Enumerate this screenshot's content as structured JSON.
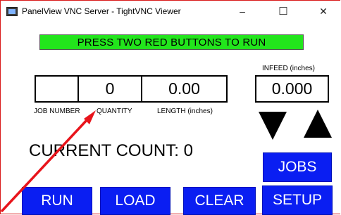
{
  "window": {
    "title": "PanelView VNC Server - TightVNC Viewer",
    "controls": {
      "minimize": "–",
      "maximize": "☐",
      "close": "✕"
    }
  },
  "banner": {
    "text": "PRESS TWO RED BUTTONS TO RUN",
    "color": "#22e51c"
  },
  "fields": {
    "job_number": {
      "value": "",
      "label": "JOB NUMBER"
    },
    "quantity": {
      "value": "0",
      "label": "QUANTITY"
    },
    "length": {
      "value": "0.00",
      "label": "LENGTH (inches)"
    },
    "infeed": {
      "value": "0.000",
      "label": "INFEED (inches)"
    }
  },
  "jog": {
    "down_icon": "triangle-down-icon",
    "up_icon": "triangle-up-icon"
  },
  "current_count": {
    "text": "CURRENT COUNT: 0"
  },
  "buttons": {
    "jobs": "JOBS",
    "run": "RUN",
    "load": "LOAD",
    "clear": "CLEAR",
    "setup": "SETUP",
    "color": "#0a1ef2"
  },
  "annotation": {
    "arrow_color": "#e8141b"
  }
}
